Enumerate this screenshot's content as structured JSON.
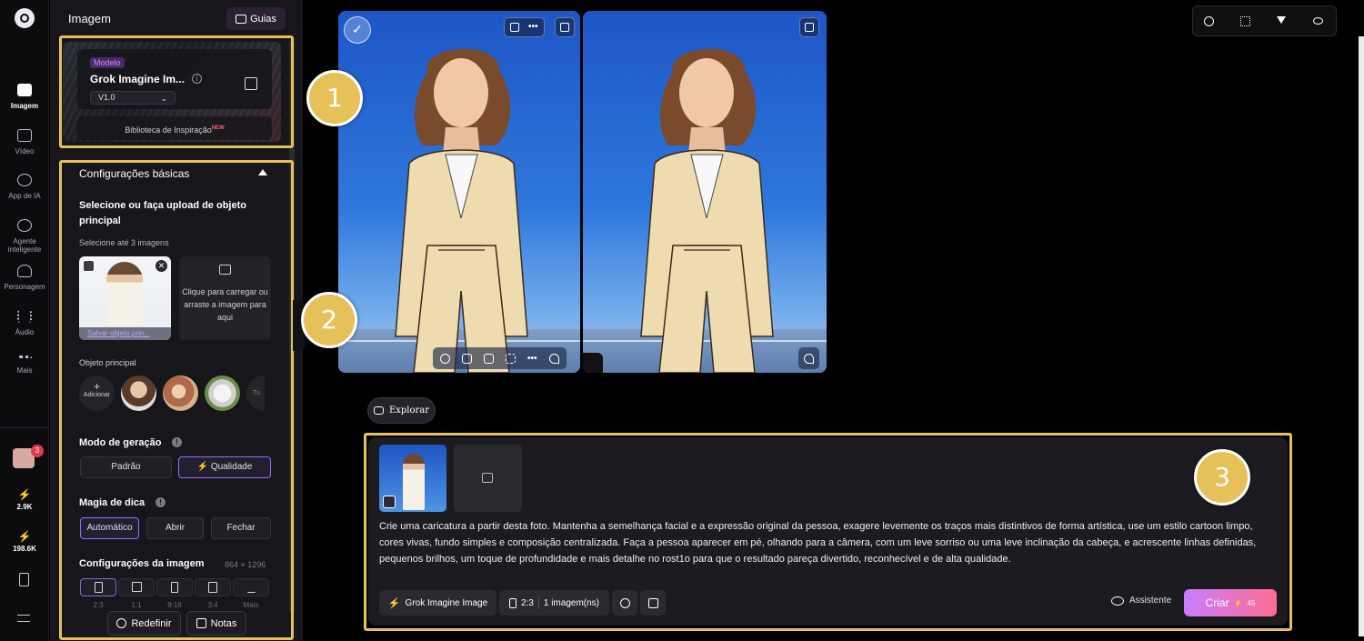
{
  "rail": {
    "items": [
      {
        "label": "Imagem",
        "icon": "image-icon",
        "active": true
      },
      {
        "label": "Vídeo",
        "icon": "video-icon"
      },
      {
        "label": "App de IA",
        "icon": "ai-app-icon"
      },
      {
        "label": "Agente inteligente",
        "icon": "agent-icon"
      },
      {
        "label": "Personagem",
        "icon": "character-icon"
      },
      {
        "label": "Áudio",
        "icon": "audio-wave-icon"
      },
      {
        "label": "Mais",
        "icon": "more-dots-icon"
      }
    ],
    "gift_badge": "3",
    "credits_bolt": "2.9K",
    "credits_purple": "198.6K",
    "logo_icon": "app-logo-icon"
  },
  "panel": {
    "title": "Imagem",
    "guides_label": "Guias",
    "model": {
      "tag": "Modelo",
      "name": "Grok Imagine Im...",
      "version": "V1.0",
      "inspiration_label": "Biblioteca de Inspiração",
      "inspiration_badge": "NEW"
    },
    "basic_settings_label": "Configurações básicas",
    "select_upload_label": "Selecione ou faça upload de objeto principal",
    "select_hint": "Selecione até 3 imagens",
    "save_subject_label": "Salvar objeto prin...",
    "upload_text": "Clique para carregar ou arraste a imagem para aqui",
    "main_object_label": "Objeto principal",
    "add_label": "Adicionar",
    "more_label": "Tu",
    "generation_mode": {
      "label": "Modo de geração",
      "options": [
        "Padrão",
        "Qualidade"
      ],
      "selected": "Qualidade"
    },
    "prompt_magic": {
      "label": "Magia de dica",
      "options": [
        "Automático",
        "Abrir",
        "Fechar"
      ],
      "selected": "Automático"
    },
    "image_settings": {
      "label": "Configurações da imagem",
      "size": "864 × 1296",
      "ratios": [
        "2:3",
        "1:1",
        "9:16",
        "3:4",
        "Mais"
      ],
      "selected": "2:3"
    },
    "reset_label": "Redefinir",
    "notes_label": "Notas"
  },
  "explore_label": "Explorar",
  "composer": {
    "prompt": "Crie uma caricatura a partir desta foto. Mantenha a semelhança facial e a expressão original da pessoa, exagere levemente os traços mais distintivos de forma artística, use um estilo cartoon limpo, cores vivas, fundo simples e composição centralizada. Faça a pessoa aparecer em pé, olhando para a câmera, com um leve sorriso ou uma leve inclinação da cabeça, e acrescente linhas definidas, pequenos brilhos, um toque de profundidade e mais detalhe no rost1o para que o resultado pareça divertido, reconhecível e de alta qualidade.",
    "model_chip": "Grok Imagine Image",
    "ratio_chip": "2:3",
    "count_chip": "1 imagem(ns)",
    "assistant_label": "Assistente",
    "create_label": "Criar",
    "create_cost": "45"
  },
  "callouts": [
    "1",
    "2",
    "3"
  ],
  "colors": {
    "highlight": "#e6c15a",
    "accent_purple": "#9c6bff",
    "create_gradient_start": "#c77dff",
    "create_gradient_end": "#ff6b93"
  }
}
